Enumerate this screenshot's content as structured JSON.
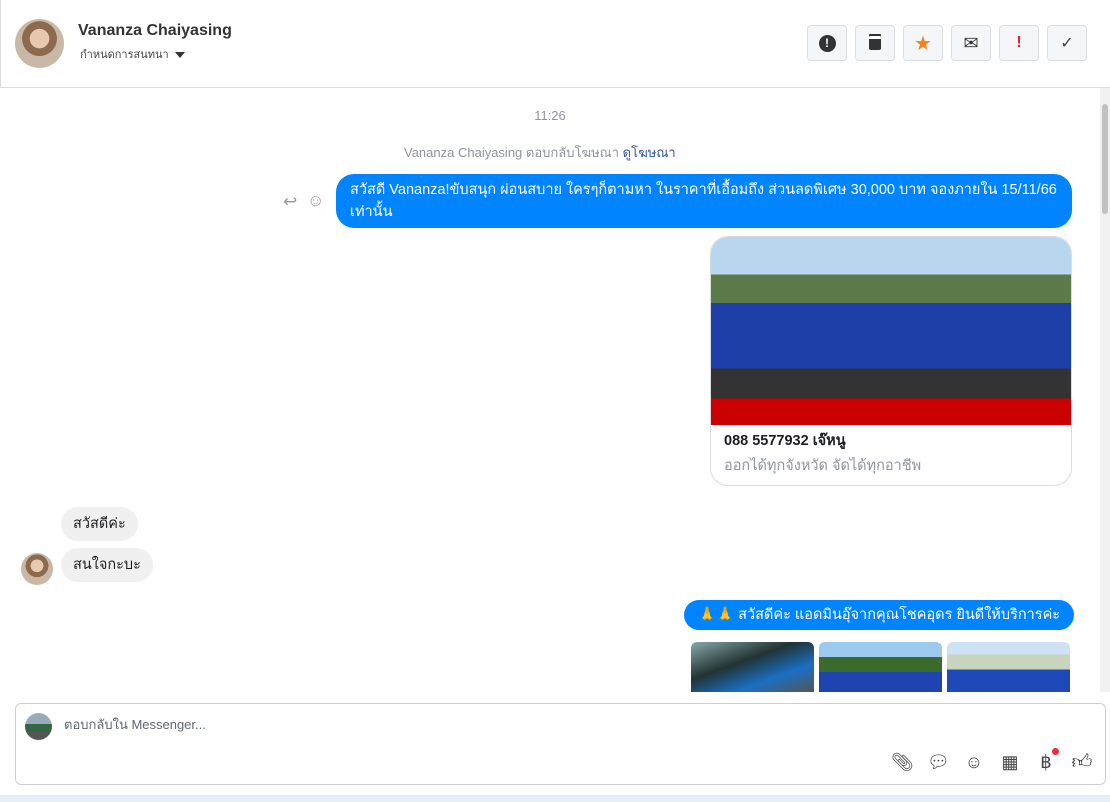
{
  "header": {
    "name": "Vananza Chaiyasing",
    "subtitle": "กำหนดการสนทนา",
    "actions": [
      {
        "icon": "alert-circle-icon",
        "glyph": "❗"
      },
      {
        "icon": "trash-icon",
        "glyph": "🗑"
      },
      {
        "icon": "star-icon",
        "glyph": "★"
      },
      {
        "icon": "envelope-icon",
        "glyph": "✉"
      },
      {
        "icon": "exclamation-icon",
        "glyph": "!"
      },
      {
        "icon": "check-icon",
        "glyph": "✓"
      }
    ]
  },
  "chat": {
    "time": "11:26",
    "reply_note": "Vananza Chaiyasing ตอบกลับโฆษณา",
    "view_ad": "ดูโฆษณา",
    "msg1": "สวัสดี Vananza!ขับสนุก ผ่อนสบาย ใครๆก็ตามหา ในราคาที่เอื้อมถึง ส่วนลดพิเศษ 30,000 บาท จองภายใน 15/11/66 เท่านั้น",
    "card_title": "088 5577932 เจ๊หนู",
    "card_sub": "ออกได้ทุกจังหวัด จัดได้ทุกอาชีพ",
    "in1": "สวัสดีค่ะ",
    "in2": "สนใจกะบะ",
    "msg2": "🙏🙏 สวัสดีค่ะ แอดมินอุ๊จากคุณโชคอุดร ยินดีให้บริการค่ะ"
  },
  "composer": {
    "placeholder": "ตอบกลับใน Messenger...",
    "tools": [
      "paperclip-icon",
      "chat-bubble-icon",
      "emoji-icon",
      "table-icon",
      "baht-icon",
      "thumbs-up-icon"
    ]
  }
}
